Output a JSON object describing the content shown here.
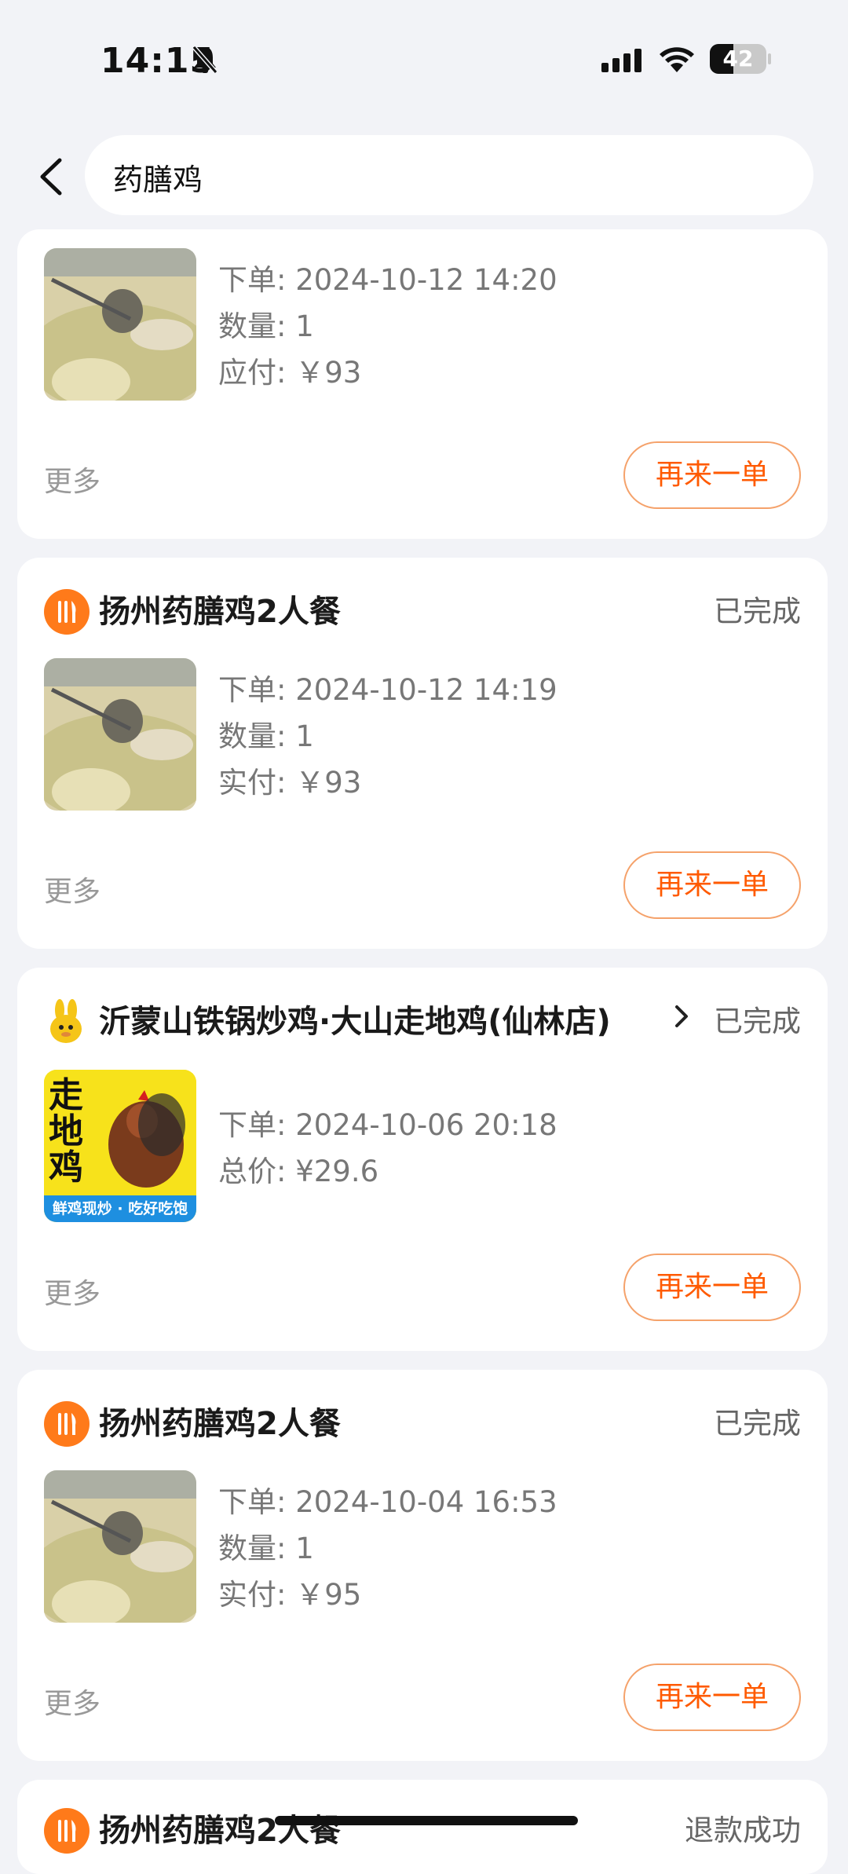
{
  "status_bar": {
    "time": "14:15",
    "battery": "42",
    "battery_level": 0.42
  },
  "search": {
    "query": "药膳鸡"
  },
  "labels": {
    "more": "更多",
    "reorder": "再来一单"
  },
  "orders": [
    {
      "details": [
        "下单: 2024-10-12 14:20",
        "数量: 1",
        "应付: ￥93"
      ]
    },
    {
      "shop": "扬州药膳鸡2人餐",
      "status": "已完成",
      "details": [
        "下单: 2024-10-12 14:19",
        "数量: 1",
        "实付: ￥93"
      ]
    },
    {
      "shop": "沂蒙山铁锅炒鸡·大山走地鸡(仙林店)",
      "status": "已完成",
      "details": [
        "下单: 2024-10-06 20:18",
        "总价: ¥29.6"
      ],
      "thumb_title": "走地鸡",
      "thumb_banner": "鲜鸡现炒 · 吃好吃饱"
    },
    {
      "shop": "扬州药膳鸡2人餐",
      "status": "已完成",
      "details": [
        "下单: 2024-10-04 16:53",
        "数量: 1",
        "实付: ￥95"
      ]
    },
    {
      "shop": "扬州药膳鸡2人餐",
      "status": "退款成功"
    }
  ]
}
